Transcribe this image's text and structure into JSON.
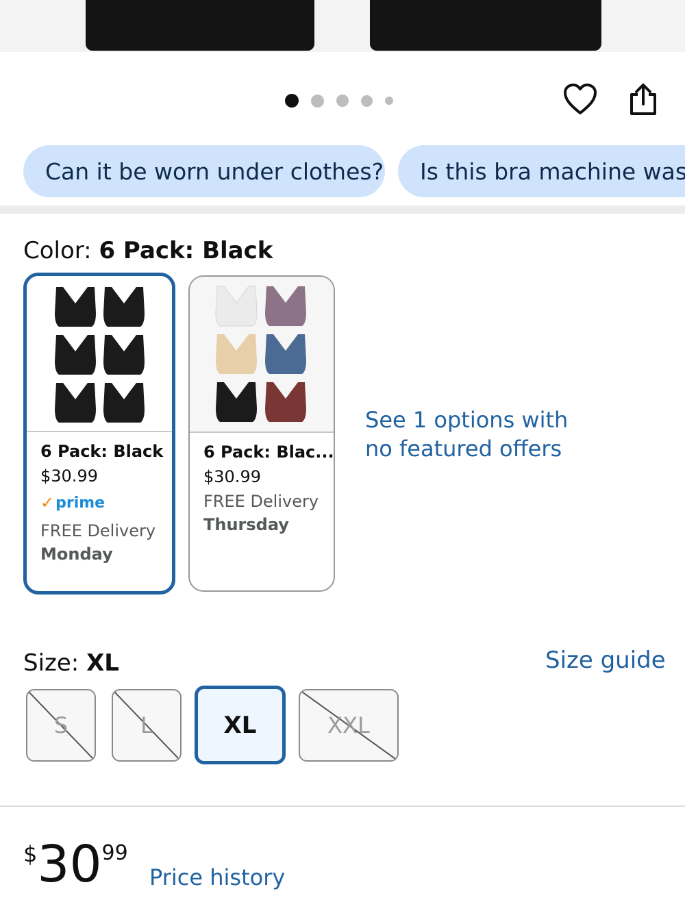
{
  "carousel": {
    "dot_count": 5,
    "active_index": 0
  },
  "actions": {
    "favorite_icon": "heart-icon",
    "share_icon": "share-icon"
  },
  "questions": [
    {
      "label": "Can it be worn under clothes?"
    },
    {
      "label": "Is this bra machine washa"
    }
  ],
  "color": {
    "label": "Color: ",
    "selected": "6 Pack: Black",
    "options": [
      {
        "title": "6 Pack: Black",
        "price": "$30.99",
        "prime": "prime",
        "delivery": "FREE Delivery",
        "day": "Monday",
        "selected": true
      },
      {
        "title": "6 Pack: Blac...",
        "price": "$30.99",
        "delivery": "FREE Delivery",
        "day": "Thursday",
        "selected": false
      }
    ],
    "see_options": "See 1 options with no featured offers"
  },
  "size": {
    "label": "Size: ",
    "selected": "XL",
    "guide": "Size guide",
    "options": [
      {
        "label": "S",
        "available": false
      },
      {
        "label": "L",
        "available": false
      },
      {
        "label": "XL",
        "available": true
      },
      {
        "label": "XXL",
        "available": false
      }
    ]
  },
  "price": {
    "symbol": "$",
    "whole": "30",
    "fraction": "99",
    "history": "Price history"
  },
  "colors": {
    "link": "#2162a1",
    "chip": "#cfe4fc",
    "selected_border": "#2162a1",
    "prime": "#1a8cd8",
    "prime_check": "#f08804"
  }
}
